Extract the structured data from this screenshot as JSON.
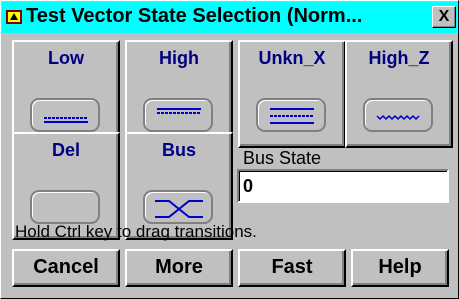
{
  "window": {
    "title": "Test Vector State Selection (Norm...",
    "close_label": "X"
  },
  "states": [
    {
      "label": "Low",
      "icon": "low-line-icon"
    },
    {
      "label": "High",
      "icon": "high-line-icon"
    },
    {
      "label": "Unkn_X",
      "icon": "unknown-lines-icon"
    },
    {
      "label": "High_Z",
      "icon": "high-z-wave-icon"
    },
    {
      "label": "Del",
      "icon": "delete-blank-icon"
    },
    {
      "label": "Bus",
      "icon": "bus-crossover-icon"
    }
  ],
  "bus_state": {
    "label": "Bus State",
    "value": "0"
  },
  "hint": "Hold Ctrl key to drag transitions.",
  "buttons": {
    "cancel": "Cancel",
    "more": "More",
    "fast": "Fast",
    "help": "Help"
  },
  "colors": {
    "titlebar": "#00ffff",
    "face": "#c0c0c0",
    "label": "#000080",
    "icon_line": "#0000cc"
  }
}
